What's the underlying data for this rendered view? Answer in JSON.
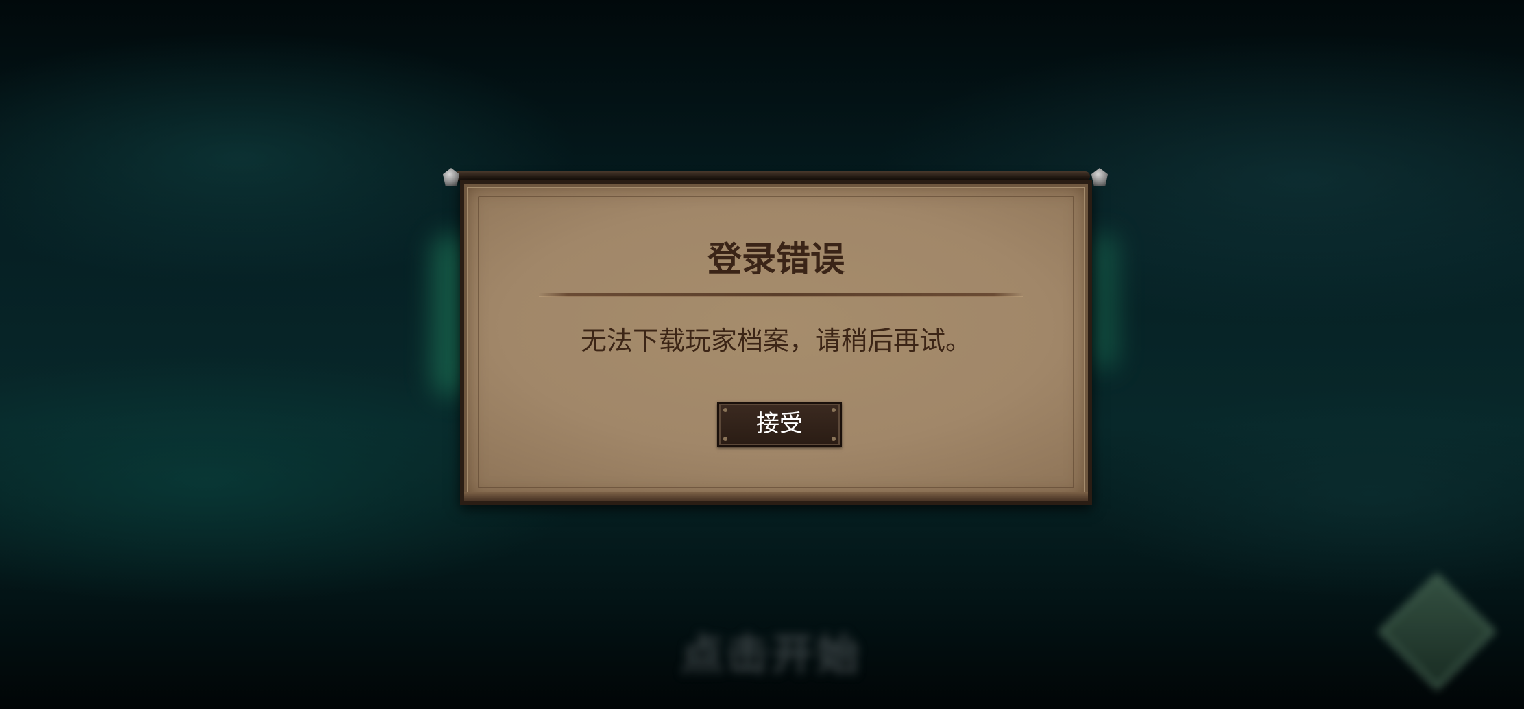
{
  "background": {
    "tap_to_start": "点击开始",
    "corner_label": "(blurred)"
  },
  "dialog": {
    "title": "登录错误",
    "message": "无法下载玩家档案，请稍后再试。",
    "accept_label": "接受"
  },
  "colors": {
    "parchment": "#a68d6c",
    "title_text": "#3a2417",
    "button_bg": "#2a1c14",
    "button_text": "#ffffff",
    "backdrop_teal": "#08282a"
  }
}
